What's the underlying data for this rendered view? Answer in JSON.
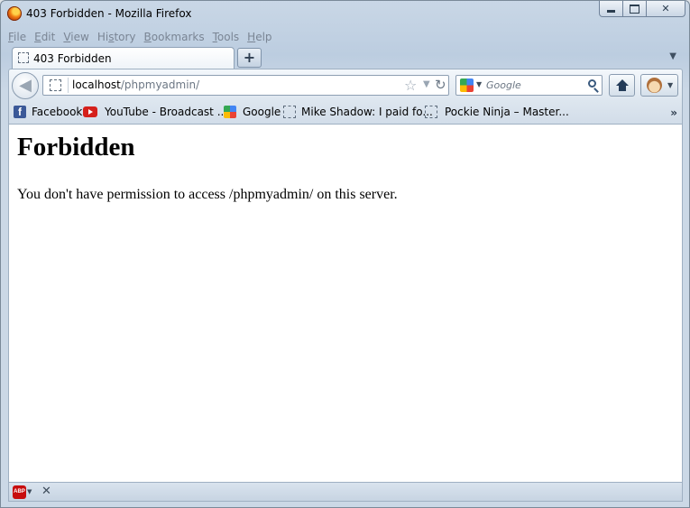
{
  "window": {
    "title": "403 Forbidden - Mozilla Firefox",
    "caption_min": "",
    "caption_max": "",
    "caption_close": "✕"
  },
  "menu": {
    "items": [
      {
        "pre": "",
        "u": "F",
        "post": "ile"
      },
      {
        "pre": "",
        "u": "E",
        "post": "dit"
      },
      {
        "pre": "",
        "u": "V",
        "post": "iew"
      },
      {
        "pre": "Hi",
        "u": "s",
        "post": "tory"
      },
      {
        "pre": "",
        "u": "B",
        "post": "ookmarks"
      },
      {
        "pre": "",
        "u": "T",
        "post": "ools"
      },
      {
        "pre": "",
        "u": "H",
        "post": "elp"
      }
    ]
  },
  "tabs": {
    "active_label": "403 Forbidden",
    "new_tab": "+",
    "list_all": "▼"
  },
  "nav": {
    "back": "◀",
    "url_host": "localhost",
    "url_path": "/phpmyadmin/",
    "star": "☆",
    "dropmarker": "▼",
    "reload": "↻",
    "search_placeholder": "Google",
    "engine_drop": "▼",
    "addon_drop": "▼"
  },
  "bookmarks": {
    "items": [
      {
        "label": "Facebook",
        "icon": "facebook-icon",
        "glyph": "f"
      },
      {
        "label": "YouTube - Broadcast ...",
        "icon": "youtube-icon"
      },
      {
        "label": "Google",
        "icon": "google-icon"
      },
      {
        "label": "Mike Shadow: I paid fo...",
        "icon": "blank-page-icon"
      },
      {
        "label": "Pockie Ninja – Master...",
        "icon": "blank-page-icon"
      }
    ],
    "overflow": "»"
  },
  "page": {
    "heading": "Forbidden",
    "message": "You don't have permission to access /phpmyadmin/ on this server."
  },
  "addonbar": {
    "abp_label": "ABP",
    "abp_drop": "▼",
    "close": "✕"
  }
}
